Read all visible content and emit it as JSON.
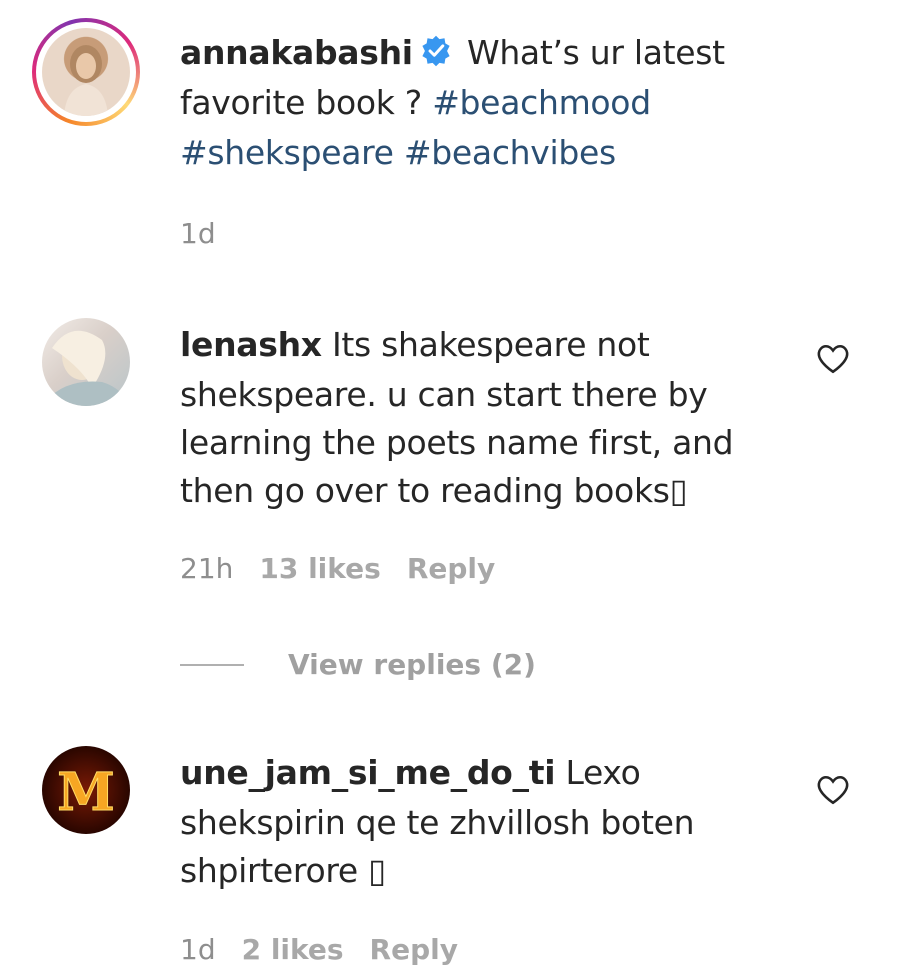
{
  "caption": {
    "username": "annakabashi",
    "text_line1": "What’s ur latest",
    "text_line2_plain": "favorite book ?",
    "hashtag1": "#beachmood",
    "hashtag2": "#shekspeare",
    "hashtag3": "#beachvibes",
    "time": "1d"
  },
  "comments": [
    {
      "username": "lenashx",
      "line1": "Its shakespeare not",
      "line2": "shekspeare. u can start there by",
      "line3": "learning the poets name first, and",
      "line4": "then go over to reading books▯",
      "time": "21h",
      "likes": "13 likes",
      "reply": "Reply",
      "view_replies": "View replies (2)"
    },
    {
      "username": "une_jam_si_me_do_ti",
      "line1": "Lexo",
      "line2": "shekspirin qe te zhvillosh boten",
      "line3": "shpirterore ▯",
      "time": "1d",
      "likes": "2 likes",
      "reply": "Reply",
      "avatar_letter": "M"
    }
  ],
  "colors": {
    "hashtag": "#2b4f73",
    "verified": "#3897f0",
    "meta": "#8e8e8e"
  },
  "icons": [
    "verified-badge-icon",
    "heart-icon"
  ]
}
